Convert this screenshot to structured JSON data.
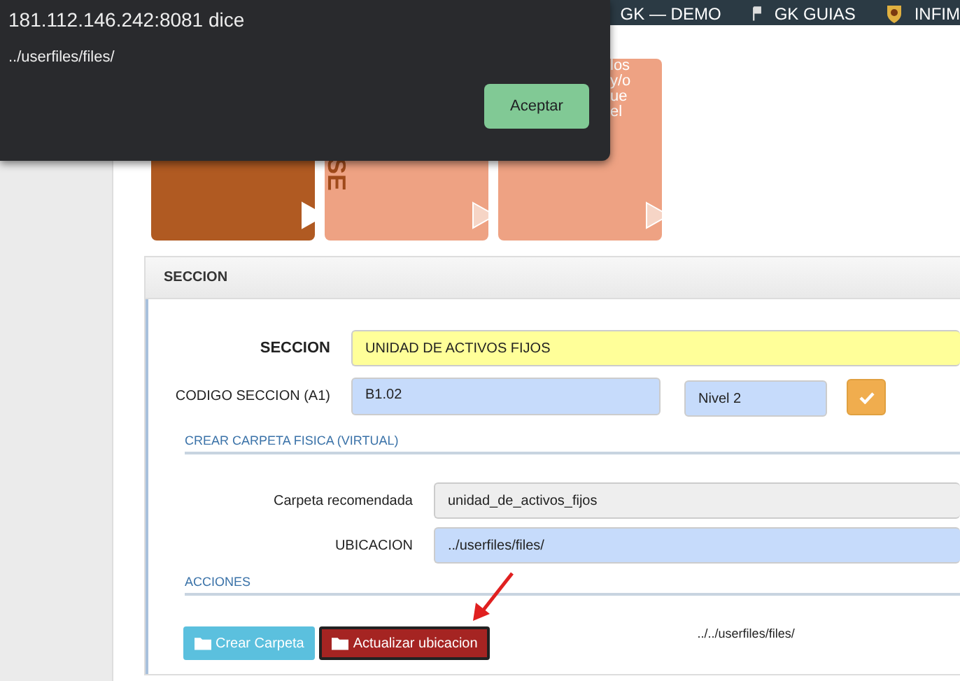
{
  "top_nav": {
    "items": [
      {
        "label": "GK — DEMO"
      },
      {
        "label": "GK GUIAS"
      },
      {
        "label": "INFIM"
      }
    ]
  },
  "step_cards": [
    {
      "selected": true
    },
    {
      "selected": false,
      "text": "SE"
    },
    {
      "selected": false,
      "lines": [
        "los",
        "y/o",
        "ue",
        "el"
      ]
    }
  ],
  "panel": {
    "title": "SECCION",
    "seccion": {
      "label": "SECCION",
      "value": "UNIDAD DE ACTIVOS FIJOS"
    },
    "codigo": {
      "label": "CODIGO SECCION (A1)",
      "value": "B1.02",
      "nivel": "Nivel 2"
    },
    "carpeta_heading": "CREAR CARPETA FISICA (VIRTUAL)",
    "carpeta_recomendada": {
      "label": "Carpeta recomendada",
      "value": "unidad_de_activos_fijos"
    },
    "ubicacion": {
      "label": "UBICACION",
      "value": "../userfiles/files/"
    },
    "acciones_heading": "ACCIONES",
    "buttons": [
      {
        "label": "Crear Carpeta",
        "kind": "info"
      },
      {
        "label": "Actualizar ubicacion",
        "kind": "danger"
      }
    ],
    "path_text": "../../userfiles/files/"
  },
  "dialog": {
    "title": "181.112.146.242:8081 dice",
    "message": "../userfiles/files/",
    "button": "Aceptar"
  }
}
